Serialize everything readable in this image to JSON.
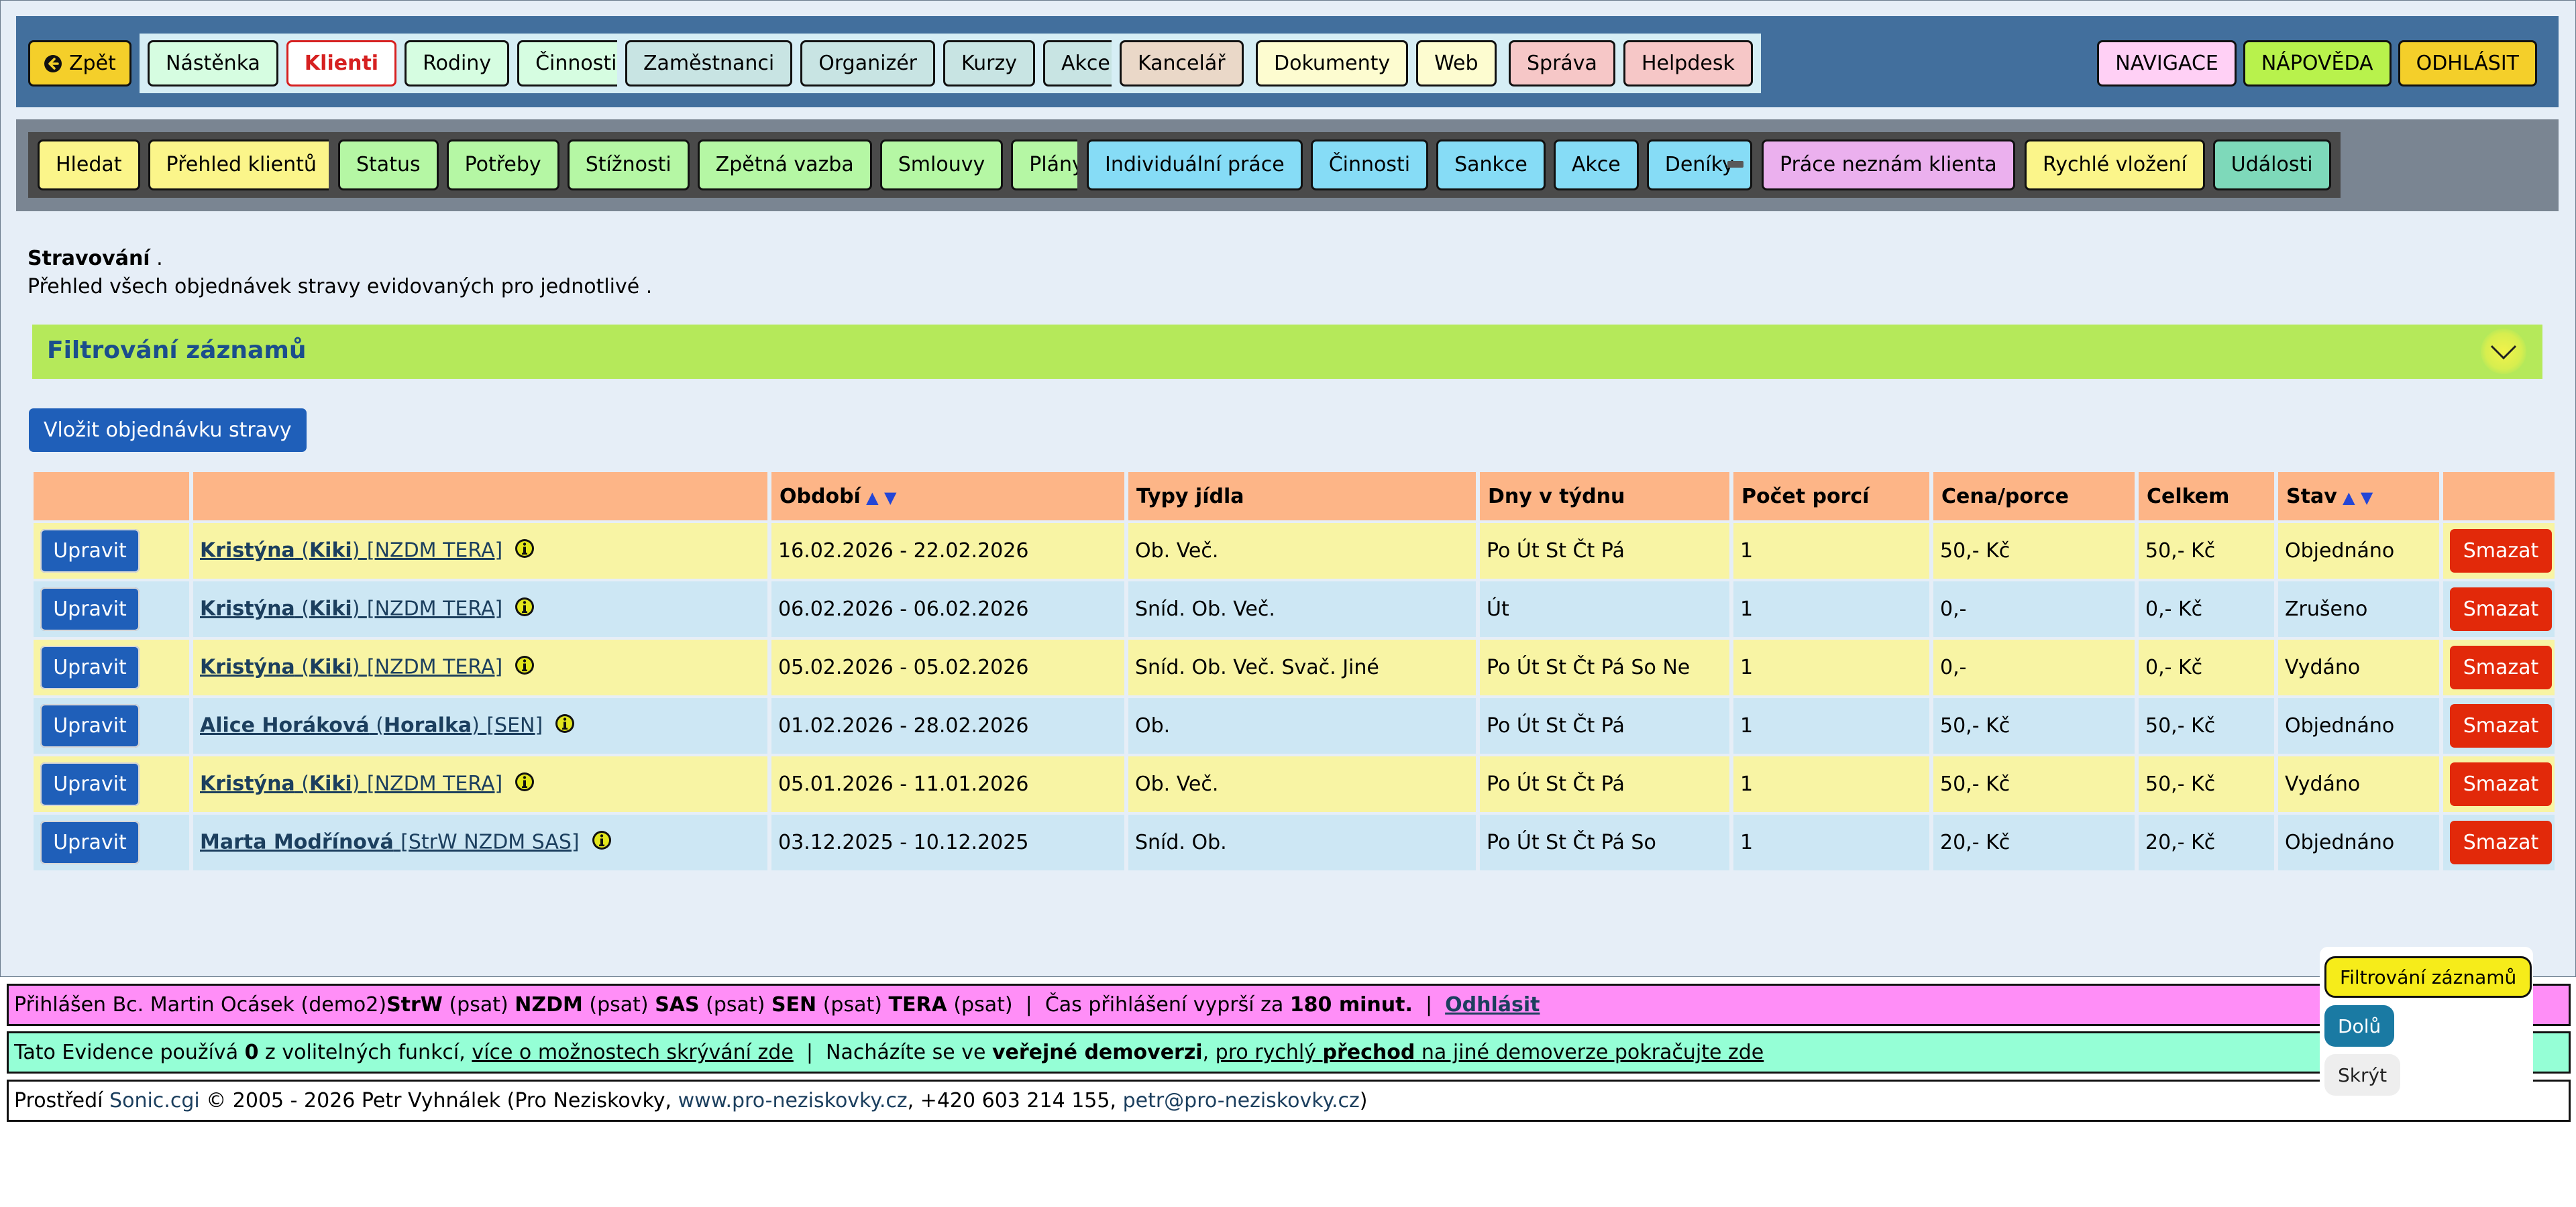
{
  "nav": {
    "back": "Zpět",
    "groups": [
      [
        {
          "label": "Nástěnka",
          "bg": "#d6fde1"
        },
        {
          "label": "Klienti",
          "bg": "#ffffff",
          "fg": "#d62020",
          "border": "#d62020"
        },
        {
          "label": "Rodiny",
          "bg": "#d6fde1"
        },
        {
          "label": "Činnosti",
          "bg": "#d6fde1"
        }
      ],
      [
        {
          "label": "Zaměstnanci",
          "bg": "#c8e4e3"
        },
        {
          "label": "Organizér",
          "bg": "#c8e4e3"
        },
        {
          "label": "Kurzy",
          "bg": "#c8e4e3"
        },
        {
          "label": "Akce",
          "bg": "#c8e4e3"
        }
      ],
      [
        {
          "label": "Kancelář",
          "bg": "#ead8c8"
        }
      ],
      [
        {
          "label": "Dokumenty",
          "bg": "#fdfcd0"
        },
        {
          "label": "Web",
          "bg": "#fdfcd0"
        }
      ],
      [
        {
          "label": "Správa",
          "bg": "#f6c7c7"
        },
        {
          "label": "Helpdesk",
          "bg": "#f6c7c7"
        }
      ]
    ],
    "right": [
      {
        "label": "NAVIGACE",
        "bg": "#ffd0f5"
      },
      {
        "label": "NÁPOVĚDA",
        "bg": "#b8f24c"
      },
      {
        "label": "ODHLÁSIT",
        "bg": "#f4cf2a"
      }
    ]
  },
  "subnav": {
    "groups": [
      [
        {
          "label": "Hledat",
          "bg": "#fbf58a"
        },
        {
          "label": "Přehled klientů",
          "bg": "#fbf58a"
        }
      ],
      [
        {
          "label": "Status",
          "bg": "#b5f7a4"
        },
        {
          "label": "Potřeby",
          "bg": "#b5f7a4"
        },
        {
          "label": "Stížnosti",
          "bg": "#b5f7a4"
        },
        {
          "label": "Zpětná vazba",
          "bg": "#b5f7a4"
        },
        {
          "label": "Smlouvy",
          "bg": "#b5f7a4"
        },
        {
          "label": "Plány",
          "bg": "#b5f7a4"
        }
      ],
      [
        {
          "label": "Individuální práce",
          "bg": "#86dcf6"
        },
        {
          "label": "Činnosti",
          "bg": "#86dcf6"
        },
        {
          "label": "Sankce",
          "bg": "#86dcf6"
        },
        {
          "label": "Akce",
          "bg": "#86dcf6"
        },
        {
          "label": "Deníky",
          "bg": "#86dcf6"
        }
      ],
      [
        {
          "label": "Práce neznám klienta",
          "bg": "#ebb0ee"
        }
      ],
      [
        {
          "label": "Rychlé vložení",
          "bg": "#fbf58a"
        },
        {
          "label": "Události",
          "bg": "#7ed9ba"
        }
      ]
    ]
  },
  "page": {
    "title": "Stravování",
    "title_suffix": " .",
    "subtitle": "Přehled všech objednávek stravy evidovaných pro jednotlivé ."
  },
  "filter": {
    "title": "Filtrování záznamů"
  },
  "insert_label": "Vložit objednávku stravy",
  "table": {
    "headers": [
      "",
      "",
      "Období",
      "Typy jídla",
      "Dny v týdnu",
      "Počet porcí",
      "Cena/porce",
      "Celkem",
      "Stav",
      ""
    ],
    "edit_label": "Upravit",
    "delete_label": "Smazat",
    "rows": [
      {
        "first": "Kristýna",
        "nick": "Kiki",
        "tags": "[NZDM TERA]",
        "period": "16.02.2026 - 22.02.2026",
        "meals": "Ob. Več.",
        "days": "Po Út St Čt Pá",
        "portions": "1",
        "price": "50,- Kč",
        "total": "50,- Kč",
        "status": "Objednáno"
      },
      {
        "first": "Kristýna",
        "nick": "Kiki",
        "tags": "[NZDM TERA]",
        "period": "06.02.2026 - 06.02.2026",
        "meals": "Sníd. Ob. Več.",
        "days": "Út",
        "portions": "1",
        "price": "0,-",
        "total": "0,- Kč",
        "status": "Zrušeno"
      },
      {
        "first": "Kristýna",
        "nick": "Kiki",
        "tags": "[NZDM TERA]",
        "period": "05.02.2026 - 05.02.2026",
        "meals": "Sníd. Ob. Več. Svač. Jiné",
        "days": "Po Út St Čt Pá So Ne",
        "portions": "1",
        "price": "0,-",
        "total": "0,- Kč",
        "status": "Vydáno"
      },
      {
        "first": "Alice Horáková",
        "nick": "Horalka",
        "tags": "[SEN]",
        "period": "01.02.2026 - 28.02.2026",
        "meals": "Ob.",
        "days": "Po Út St Čt Pá",
        "portions": "1",
        "price": "50,- Kč",
        "total": "50,- Kč",
        "status": "Objednáno"
      },
      {
        "first": "Kristýna",
        "nick": "Kiki",
        "tags": "[NZDM TERA]",
        "period": "05.01.2026 - 11.01.2026",
        "meals": "Ob. Več.",
        "days": "Po Út St Čt Pá",
        "portions": "1",
        "price": "50,- Kč",
        "total": "50,- Kč",
        "status": "Vydáno"
      },
      {
        "first": "Marta Modřínová",
        "nick": "",
        "tags": "[StrW NZDM SAS]",
        "period": "03.12.2025 - 10.12.2025",
        "meals": "Sníd. Ob.",
        "days": "Po Út St Čt Pá So",
        "portions": "1",
        "price": "20,- Kč",
        "total": "20,- Kč",
        "status": "Objednáno"
      }
    ]
  },
  "footer": {
    "login_prefix": "Přihlášen Bc. Martin Ocásek (demo2)",
    "roles": [
      {
        "code": "StrW",
        "note": "(psat)"
      },
      {
        "code": "NZDM",
        "note": "(psat)"
      },
      {
        "code": "SAS",
        "note": "(psat)"
      },
      {
        "code": "SEN",
        "note": "(psat)"
      },
      {
        "code": "TERA",
        "note": "(psat)"
      }
    ],
    "expire_prefix": "Čas přihlášení vyprší za",
    "expire_value": "180 minut.",
    "logout_link": "Odhlásit",
    "evidence_prefix": "Tato Evidence používá",
    "evidence_count": "0",
    "evidence_mid": "z volitelných funkcí,",
    "evidence_link": "více o možnostech skrývání zde",
    "demo_prefix": "Nacházíte se ve",
    "demo_bold": "veřejné demoverzi",
    "demo_link_a": "pro rychlý",
    "demo_link_b": "přechod",
    "demo_link_c": "na jiné demoverze pokračujte zde",
    "env_prefix": "Prostředí",
    "env_link": "Sonic.cgi",
    "env_copy": "© 2005 - 2026 Petr Vyhnálek (Pro Neziskovky,",
    "env_web": "www.pro-neziskovky.cz",
    "env_phone": ", +420 603 214 155,",
    "env_mail": "petr@pro-neziskovky.cz",
    "env_close": ")"
  },
  "floating": {
    "filter": "Filtrování záznamů",
    "down": "Dolů",
    "hide": "Skrýt"
  }
}
